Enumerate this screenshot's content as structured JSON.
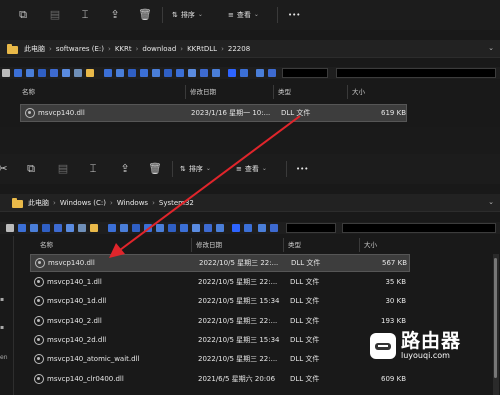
{
  "top": {
    "toolbar": {
      "sort_label": "排序",
      "view_label": "查看",
      "more_label": "•••"
    },
    "breadcrumb": [
      "此电脑",
      "softwares (E:)",
      "KKRt",
      "download",
      "KKRtDLL",
      "22208"
    ],
    "columns": [
      "名称",
      "修改日期",
      "类型",
      "大小"
    ],
    "files": [
      {
        "name": "msvcp140.dll",
        "date": "2023/1/16 星期一 10:...",
        "type": "DLL 文件",
        "size": "619 KB"
      }
    ]
  },
  "bottom": {
    "toolbar": {
      "sort_label": "排序",
      "view_label": "查看",
      "more_label": "•••"
    },
    "breadcrumb": [
      "此电脑",
      "Windows (C:)",
      "Windows",
      "System32"
    ],
    "columns": [
      "名称",
      "修改日期",
      "类型",
      "大小"
    ],
    "files": [
      {
        "name": "msvcp140.dll",
        "date": "2022/10/5 星期三 22:...",
        "type": "DLL 文件",
        "size": "567 KB"
      },
      {
        "name": "msvcp140_1.dll",
        "date": "2022/10/5 星期三 22:...",
        "type": "DLL 文件",
        "size": "35 KB"
      },
      {
        "name": "msvcp140_1d.dll",
        "date": "2022/10/5 星期三 15:34",
        "type": "DLL 文件",
        "size": "30 KB"
      },
      {
        "name": "msvcp140_2.dll",
        "date": "2022/10/5 星期三 22:...",
        "type": "DLL 文件",
        "size": "193 KB"
      },
      {
        "name": "msvcp140_2d.dll",
        "date": "2022/10/5 星期三 15:34",
        "type": "DLL 文件",
        "size": ""
      },
      {
        "name": "msvcp140_atomic_wait.dll",
        "date": "2022/10/5 星期三 22:...",
        "type": "DLL 文件",
        "size": ""
      },
      {
        "name": "msvcp140_clr0400.dll",
        "date": "2021/6/5 星期六 20:06",
        "type": "DLL 文件",
        "size": "609 KB"
      }
    ],
    "nav_fragment": "en"
  },
  "watermark": {
    "title": "路由器",
    "subtitle": "luyouqi.com"
  },
  "colors": {
    "arrow": "#e0252b",
    "folder": "#e9b949",
    "selected_row": "#3d3d3d"
  }
}
